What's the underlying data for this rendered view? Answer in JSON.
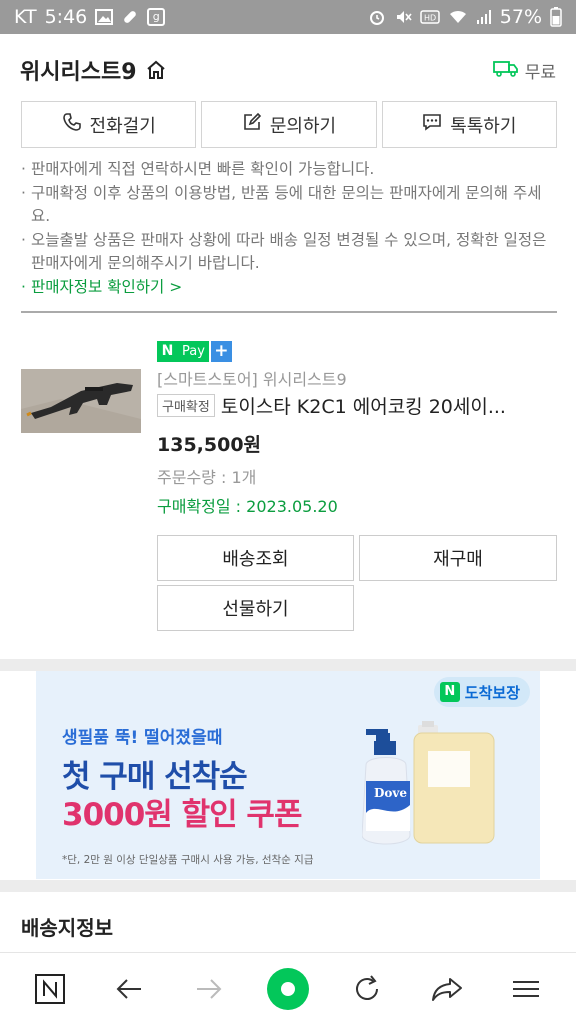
{
  "status_bar": {
    "carrier": "KT",
    "time": "5:46",
    "battery": "57%"
  },
  "header": {
    "store_name": "위시리스트9",
    "shipping_label": "무료"
  },
  "contact_buttons": [
    {
      "label": "전화걸기",
      "icon": "phone-icon"
    },
    {
      "label": "문의하기",
      "icon": "edit-icon"
    },
    {
      "label": "톡톡하기",
      "icon": "chat-icon"
    }
  ],
  "notes": [
    "판매자에게 직접 연락하시면 빠른 확인이 가능합니다.",
    "구매확정 이후 상품의 이용방법, 반품 등에 대한 문의는 판매자에게 문의해 주세요.",
    "오늘출발 상품은 판매자 상황에 따라 배송 일정 변경될 수 있으며, 정확한 일정은 판매자에게 문의해주시기 바랍니다.",
    "판매자정보 확인하기 >"
  ],
  "order": {
    "npay_label": "Pay",
    "seller": "[스마트스토어] 위시리스트9",
    "status_tag": "구매확정",
    "product_name": "토이스타 K2C1 에어코킹 20세이...",
    "price": "135,500원",
    "quantity": "주문수량 : 1개",
    "confirm_date": "구매확정일 : 2023.05.20",
    "buttons": {
      "track": "배송조회",
      "rebuy": "재구매",
      "gift": "선물하기"
    }
  },
  "banner": {
    "badge": "도착보장",
    "line1": "생필품 뚝! 떨어졌을때",
    "line2": "첫 구매 선착순",
    "line3": "3000원 할인 쿠폰",
    "fine_print": "*단, 2만 원 이상 단일상품 구매시 사용 가능, 선착순 지급",
    "product_brand": "Dove"
  },
  "shipping_section": {
    "title": "배송지정보"
  },
  "colors": {
    "naver_green": "#03c75a",
    "text_green": "#0b9d3f",
    "banner_blue": "#1f4ea9",
    "banner_pink": "#e0336d"
  }
}
